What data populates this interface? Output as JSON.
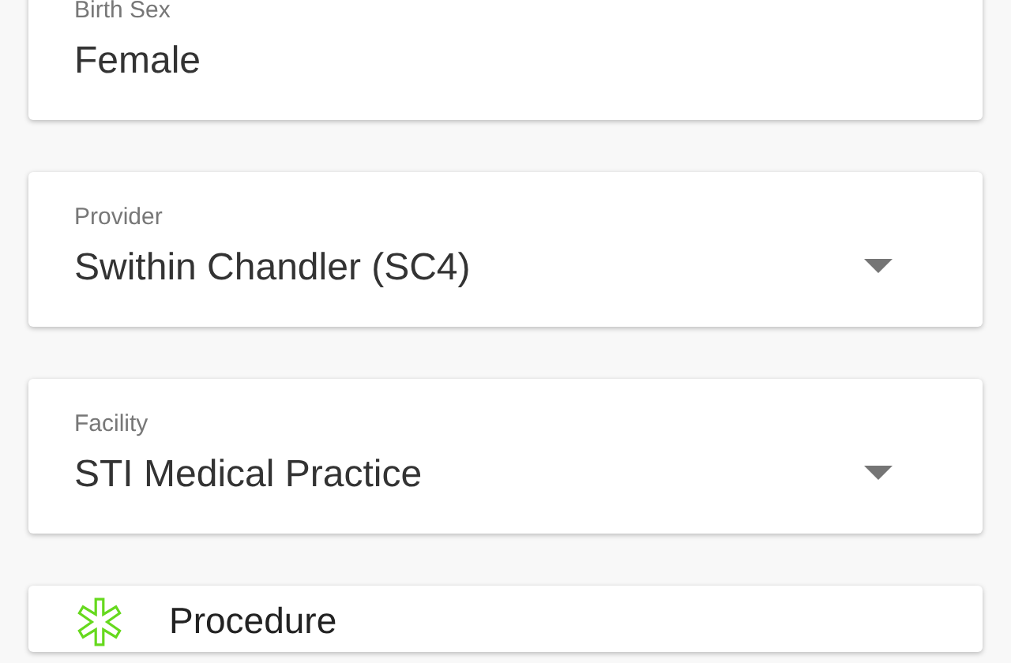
{
  "fields": [
    {
      "kind": "text",
      "label": "Birth Sex",
      "value": "Female"
    },
    {
      "kind": "dropdown",
      "label": "Provider",
      "value": "Swithin Chandler (SC4)"
    },
    {
      "kind": "dropdown",
      "label": "Facility",
      "value": "STI Medical Practice"
    }
  ],
  "section": {
    "title": "Procedure"
  }
}
